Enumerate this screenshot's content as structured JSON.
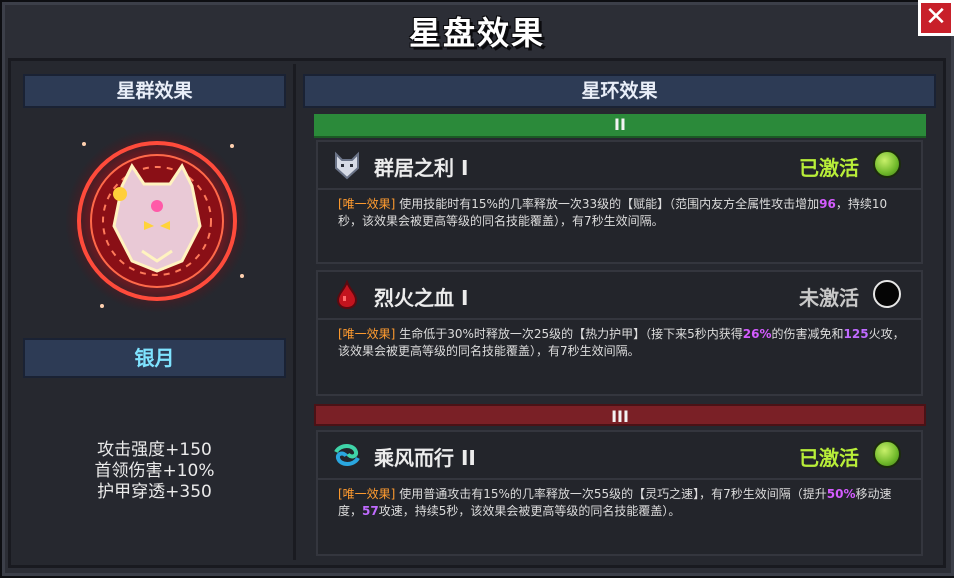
{
  "title": "星盘效果",
  "left": {
    "header": "星群效果",
    "constellation_name": "银月",
    "stats": [
      "攻击强度+150",
      "首领伤害+10%",
      "护甲穿透+350"
    ]
  },
  "right": {
    "header": "星环效果",
    "tier2_label": "II",
    "tier3_label": "III",
    "cards": [
      {
        "title": "群居之利 I",
        "status": "已激活",
        "icon": "wolf-icon",
        "tag": "[唯一效果]",
        "d1": " 使用技能时有15%的几率释放一次33级的【赋能】（范围内友方全属性攻击增加",
        "v1": "96",
        "d2": "，持续10秒，该效果会被更高等级的同名技能覆盖），有7秒生效间隔。"
      },
      {
        "title": "烈火之血 I",
        "status": "未激活",
        "icon": "blood-drop-icon",
        "tag": "[唯一效果]",
        "d1": " 生命低于30%时释放一次25级的【热力护甲】（接下来5秒内获得",
        "v1": "26%",
        "d2": "的伤害减免和",
        "v2": "125",
        "d3": "火攻，该效果会被更高等级的同名技能覆盖），有7秒生效间隔。"
      },
      {
        "title": "乘风而行 II",
        "status": "已激活",
        "icon": "wind-swirl-icon",
        "tag": "[唯一效果]",
        "d1": " 使用普通攻击有15%的几率释放一次55级的【灵巧之速】，有7秒生效间隔（提升",
        "v1": "50%",
        "d2": "移动速度，",
        "v2": "57",
        "d3": "攻速，持续5秒，该效果会被更高等级的同名技能覆盖）。"
      }
    ]
  },
  "colors": {
    "active": "#b8ee39",
    "inactive": "#c8c8c8",
    "tag": "#ff9b2f",
    "highlight": "#d45cff",
    "constellation_name": "#7fe3ff"
  }
}
